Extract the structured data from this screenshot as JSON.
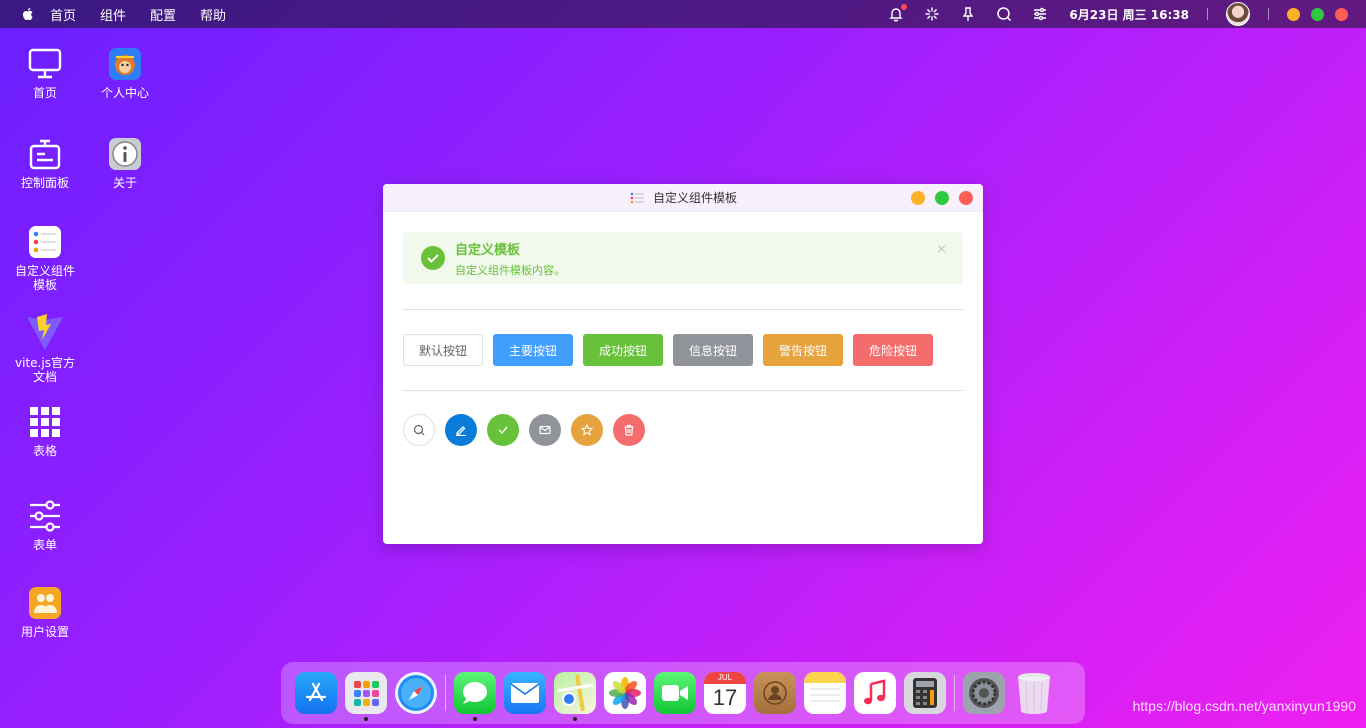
{
  "menubar": {
    "menus": [
      "首页",
      "组件",
      "配置",
      "帮助"
    ],
    "icons": [
      "bell-icon",
      "loading-icon",
      "pin-icon",
      "search-icon",
      "sliders-icon"
    ],
    "clock": "6月23日 周三 16:38"
  },
  "desktop": {
    "column1": [
      {
        "label": "首页",
        "icon": "monitor-icon"
      },
      {
        "label": "控制面板",
        "icon": "control-panel-icon"
      },
      {
        "label": "自定义组件模板",
        "icon": "list-template-icon"
      },
      {
        "label": "vite.js官方文档",
        "icon": "vite-icon"
      },
      {
        "label": "表格",
        "icon": "grid-icon"
      },
      {
        "label": "表单",
        "icon": "sliders-icon"
      },
      {
        "label": "用户设置",
        "icon": "users-icon"
      }
    ],
    "column2": [
      {
        "label": "个人中心",
        "icon": "monkey-icon"
      },
      {
        "label": "关于",
        "icon": "info-icon"
      }
    ]
  },
  "window": {
    "title": "自定义组件模板",
    "alert": {
      "title": "自定义模板",
      "description": "自定义组件模板内容。",
      "close": "×"
    },
    "buttons": [
      {
        "label": "默认按钮",
        "type": "default"
      },
      {
        "label": "主要按钮",
        "type": "primary"
      },
      {
        "label": "成功按钮",
        "type": "success"
      },
      {
        "label": "信息按钮",
        "type": "info"
      },
      {
        "label": "警告按钮",
        "type": "warning"
      },
      {
        "label": "危险按钮",
        "type": "danger"
      }
    ],
    "circle_buttons": [
      {
        "icon": "search-icon",
        "type": "default"
      },
      {
        "icon": "edit-icon",
        "type": "primary"
      },
      {
        "icon": "check-icon",
        "type": "success"
      },
      {
        "icon": "message-icon",
        "type": "info"
      },
      {
        "icon": "star-icon",
        "type": "warning"
      },
      {
        "icon": "delete-icon",
        "type": "danger"
      }
    ]
  },
  "dock": {
    "apps": [
      "app-store-icon",
      "launchpad-icon",
      "safari-icon",
      "messages-icon",
      "mail-icon",
      "maps-icon",
      "photos-icon",
      "facetime-icon",
      "calendar-icon",
      "contacts-icon",
      "notes-icon",
      "music-icon",
      "calculator-icon",
      "system-preferences-icon",
      "trash-icon"
    ],
    "calendar_month": "JUL",
    "calendar_day": "17"
  },
  "watermark": "https://blog.csdn.net/yanxinyun1990",
  "colors": {
    "primary": "#409eff",
    "success": "#67c23a",
    "info": "#909399",
    "warning": "#e6a23c",
    "danger": "#f56c6c"
  }
}
